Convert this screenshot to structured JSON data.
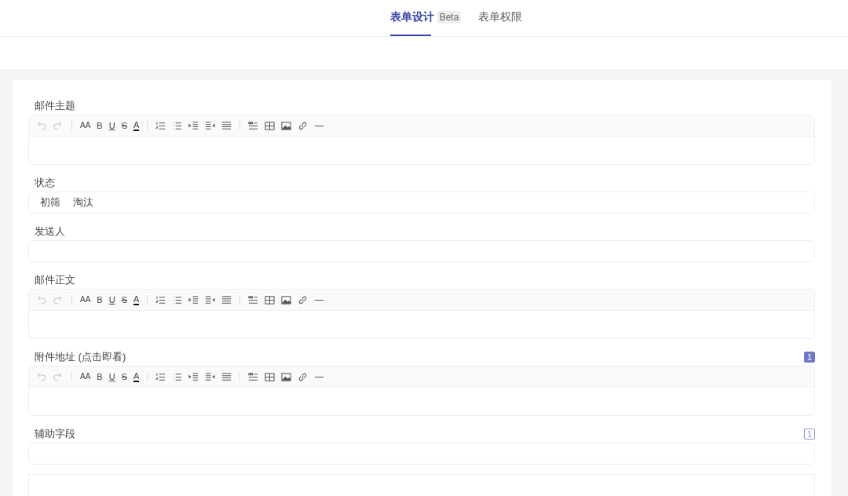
{
  "tabs": [
    {
      "label": "表单设计",
      "badge": "Beta",
      "selected": true
    },
    {
      "label": "表单权限",
      "selected": false
    }
  ],
  "fields": [
    {
      "kind": "rich",
      "label": "邮件主题",
      "toolbar": [
        "AA",
        "B",
        "U",
        "S",
        "A"
      ]
    },
    {
      "kind": "tags",
      "label": "状态",
      "tags": [
        "初筛",
        "淘汰"
      ]
    },
    {
      "kind": "text",
      "label": "发送人"
    },
    {
      "kind": "rich",
      "label": "邮件正文",
      "toolbar": [
        "AA",
        "B",
        "U",
        "S",
        "A"
      ]
    },
    {
      "kind": "rich",
      "label": "附件地址 (点击即看)",
      "toolbar": [
        "AA",
        "B",
        "U",
        "S",
        "A"
      ],
      "count": "1",
      "count_filled": true
    },
    {
      "kind": "text",
      "label": "辅助字段",
      "count": "1",
      "count_filled": false
    },
    {
      "kind": "text"
    }
  ]
}
